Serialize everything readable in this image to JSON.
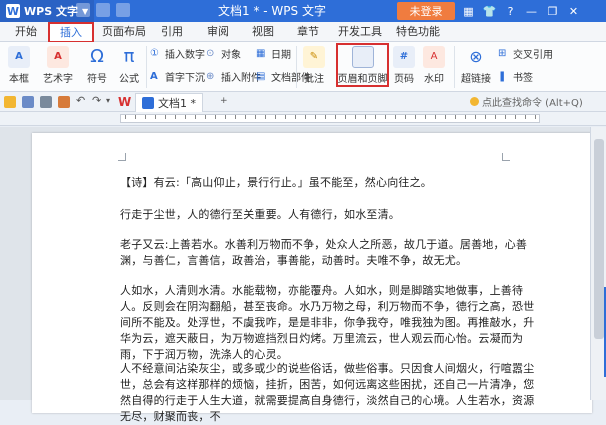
{
  "titlebar": {
    "app_name": "WPS 文字",
    "window_title": "文档1 * - WPS 文字",
    "login_label": "未登录",
    "controls": [
      "▦",
      "👕",
      "?",
      "—",
      "❐",
      "✕"
    ]
  },
  "menu": {
    "tabs": [
      "开始",
      "插入",
      "页面布局",
      "引用",
      "审阅",
      "视图",
      "章节",
      "开发工具",
      "特色功能"
    ],
    "active": "插入"
  },
  "ribbon": {
    "big_buttons": [
      {
        "label": "本框",
        "icon": "textbox-icon"
      },
      {
        "label": "艺术字",
        "icon": "wordart-icon"
      },
      {
        "label": "符号",
        "icon": "symbol-icon"
      },
      {
        "label": "公式",
        "icon": "formula-icon"
      }
    ],
    "insert_number": "插入数字",
    "object": "对象",
    "date": "日期",
    "dropcap": "首字下沉",
    "attachment": "插入附件",
    "doc_parts": "文档部件",
    "comment": "批注",
    "header_footer": "页眉和页脚",
    "page_number": "页码",
    "watermark": "水印",
    "hyperlink": "超链接",
    "cross_ref": "交叉引用",
    "bookmark": "书签",
    "symbol_glyph": "Ω",
    "formula_glyph": "π",
    "textbox_glyph": "A",
    "wordart_glyph": "A",
    "hyperlink_glyph": "⊗",
    "pagenum_glyph": "#",
    "watermark_glyph": "A",
    "comment_glyph": "✎",
    "bookmark_glyph": "❚",
    "object_glyph": "⊙",
    "crossref_glyph": "⊞",
    "date_glyph": "▦",
    "insertnum_glyph": "①",
    "dropcap_glyph": "A",
    "attach_glyph": "⊕",
    "docparts_glyph": "▤"
  },
  "docbar": {
    "doc_tab": "文档1 *",
    "tip": "点此查找命令 (Alt+Q)",
    "wps_mark": "W",
    "arrow_right": "▸",
    "arrow_down": "▾",
    "undo_glyph": "↶",
    "redo_glyph": "↷"
  },
  "document": {
    "paragraphs": [
      "【诗】有云:「高山仰止，景行行止。」虽不能至，然心向往之。",
      "行走于尘世，人的德行至关重要。人有德行，如水至清。",
      "老子又云:上善若水。水善利万物而不争，处众人之所恶，故几于道。居善地，心善渊，与善仁，言善信，政善治，事善能，动善时。夫唯不争，故无尤。",
      "人如水，人清则水清。水能载物，亦能覆舟。人如水，则是脚踏实地做事，上善待人。反则会在阴沟翻船，甚至丧命。水乃万物之母，利万物而不争，德行之高，恐世间所不能及。处浮世，不虞我咋，是是非非，你争我夺，唯我独为图。再推敲水，升华为云，遮天蔽日，为万物遮挡烈日灼烤。万里流云，世人观云而心怡。云凝而为雨，下于润万物，洗涤人的心灵。",
      "人不经意间沾染灰尘，或多或少的说些俗话，做些俗事。只因食人间烟火，行喧嚣尘世，总会有这样那样的烦恼，挂折，困苦，如何远离这些困扰，还自己一片清净，您然自得的行走于人生大道，就需要提高自身德行，淡然自己的心境。人生若水，资源无尽，财聚而丧，不"
    ]
  },
  "colors": {
    "titlebar": "#2e6ed8",
    "login": "#f07c3f",
    "highlight": "#d73030",
    "accent": "#2e6ed8"
  }
}
